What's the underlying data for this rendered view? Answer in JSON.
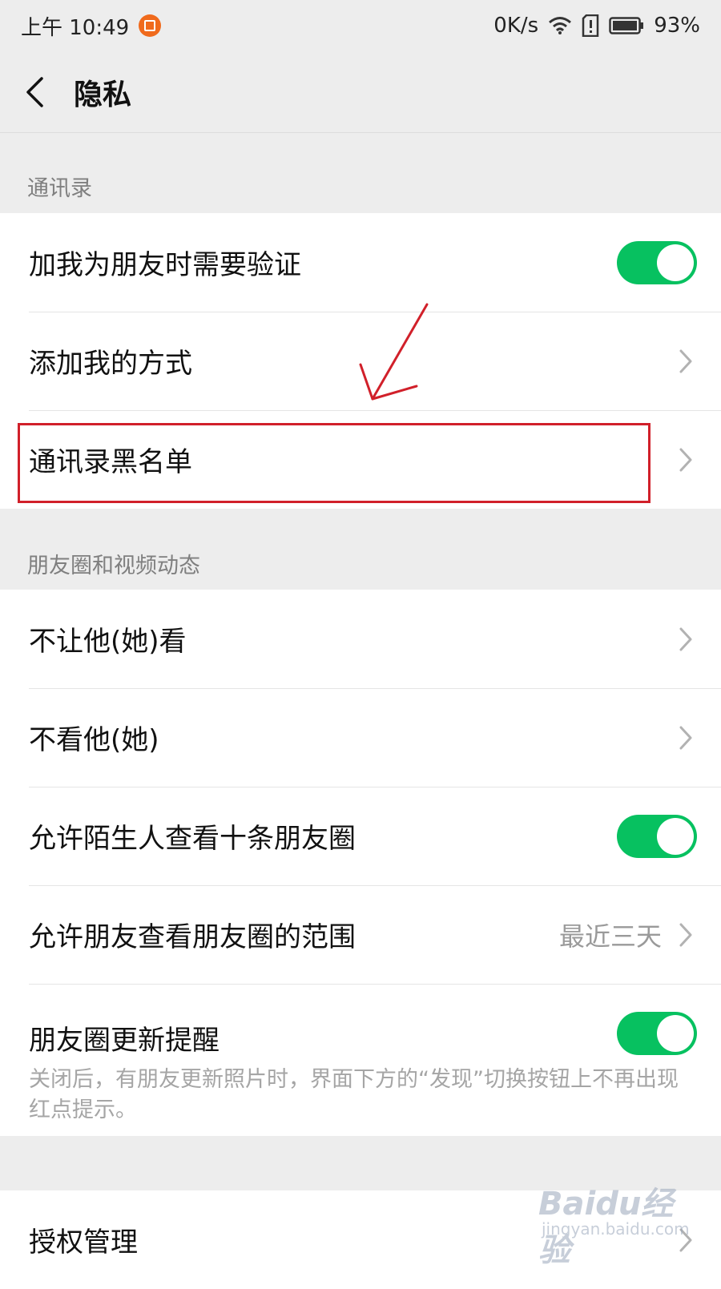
{
  "status_bar": {
    "time": "上午 10:49",
    "speed": "0K/s",
    "battery": "93%",
    "icons": [
      "notification-icon",
      "wifi-icon",
      "sim-alert-icon",
      "battery-icon"
    ]
  },
  "header": {
    "title": "隐私",
    "back_icon": "chevron-left-icon"
  },
  "sections": {
    "contacts": {
      "label": "通讯录",
      "items": [
        {
          "label": "加我为朋友时需要验证",
          "control": "toggle",
          "on": true
        },
        {
          "label": "添加我的方式",
          "control": "chevron"
        },
        {
          "label": "通讯录黑名单",
          "control": "chevron"
        }
      ]
    },
    "moments": {
      "label": "朋友圈和视频动态",
      "items": [
        {
          "label": "不让他(她)看",
          "control": "chevron"
        },
        {
          "label": "不看他(她)",
          "control": "chevron"
        },
        {
          "label": "允许陌生人查看十条朋友圈",
          "control": "toggle",
          "on": true
        },
        {
          "label": "允许朋友查看朋友圈的范围",
          "value": "最近三天",
          "control": "chevron"
        },
        {
          "label": "朋友圈更新提醒",
          "control": "toggle",
          "on": true,
          "description": "关闭后，有朋友更新照片时，界面下方的“发现”切换按钮上不再出现红点提示。"
        }
      ]
    },
    "auth": {
      "items": [
        {
          "label": "授权管理",
          "control": "chevron"
        }
      ]
    }
  },
  "annotation": {
    "highlight_color": "#d1202a"
  },
  "colors": {
    "toggle_on": "#07c160",
    "background": "#ededed"
  },
  "watermark": {
    "brand": "Baidu经验",
    "url": "jingyan.baidu.com"
  }
}
